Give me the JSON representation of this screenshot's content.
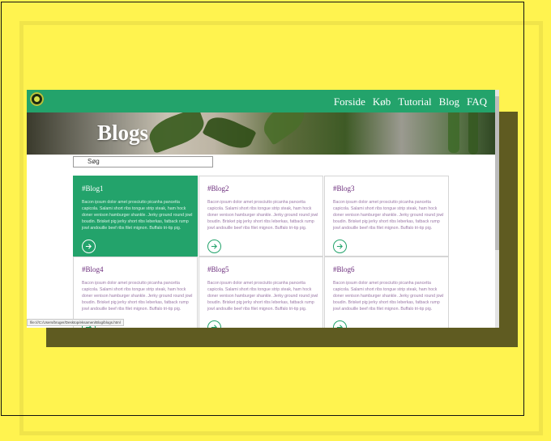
{
  "nav": {
    "links": [
      "Forside",
      "Køb",
      "Tutorial",
      "Blog",
      "FAQ"
    ]
  },
  "hero": {
    "title": "Blogs"
  },
  "search": {
    "placeholder": "Søg"
  },
  "cards": [
    {
      "title": "#Blog1",
      "text": "Bacon ipsum dolor amet prosciutto picanha pancetta capicola. Salami short ribs tongue strip steak, ham hock doner venison hamburger shankle. Jerky ground round jowl boudin. Brisket pig jerky short ribs leberkas, fatback rump jowl andouille beef ribs filet mignon. Buffalo tri-tip pig."
    },
    {
      "title": "#Blog2",
      "text": "Bacon ipsum dolor amet prosciutto picanha pancetta capicola. Salami short ribs tongue strip steak, ham hock doner venison hamburger shankle. Jerky ground round jowl boudin. Brisket pig jerky short ribs leberkas, fatback rump jowl andouille beef ribs filet mignon. Buffalo tri-tip pig."
    },
    {
      "title": "#Blog3",
      "text": "Bacon ipsum dolor amet prosciutto picanha pancetta capicola. Salami short ribs tongue strip steak, ham hock doner venison hamburger shankle. Jerky ground round jowl boudin. Brisket pig jerky short ribs leberkas, fatback rump jowl andouille beef ribs filet mignon. Buffalo tri-tip pig."
    },
    {
      "title": "#Blog4",
      "text": "Bacon ipsum dolor amet prosciutto picanha pancetta capicola. Salami short ribs tongue strip steak, ham hock doner venison hamburger shankle. Jerky ground round jowl boudin. Brisket pig jerky short ribs leberkas, fatback rump jowl andouille beef ribs filet mignon. Buffalo tri-tip pig."
    },
    {
      "title": "#Blog5",
      "text": "Bacon ipsum dolor amet prosciutto picanha pancetta capicola. Salami short ribs tongue strip steak, ham hock doner venison hamburger shankle. Jerky ground round jowl boudin. Brisket pig jerky short ribs leberkas, fatback rump jowl andouille beef ribs filet mignon. Buffalo tri-tip pig."
    },
    {
      "title": "#Blog6",
      "text": "Bacon ipsum dolor amet prosciutto picanha pancetta capicola. Salami short ribs tongue strip steak, ham hock doner venison hamburger shankle. Jerky ground round jowl boudin. Brisket pig jerky short ribs leberkas, fatback rump jowl andouille beef ribs filet mignon. Buffalo tri-tip pig."
    }
  ],
  "active_card": "#Blog1",
  "status_bar": {
    "url": "file:///C:/Users/bruger/Desktop/eksamen/Blog/blogs.html"
  },
  "colors": {
    "brand_green": "#23a36b",
    "background_yellow": "#fff34f",
    "title_purple": "#6a2a7a"
  },
  "icons": {
    "logo": "plant-logo-icon",
    "card_button": "arrow-right-circle-icon"
  }
}
